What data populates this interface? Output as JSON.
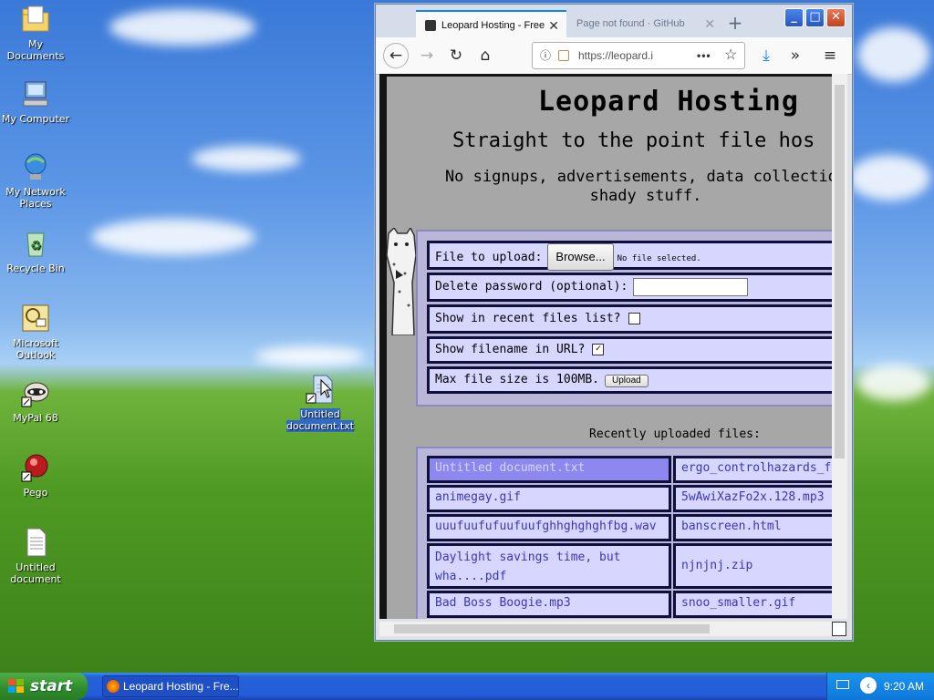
{
  "desktop": {
    "icons": [
      {
        "label": "My Documents",
        "icon": "folder-documents-icon"
      },
      {
        "label": "My Computer",
        "icon": "computer-icon"
      },
      {
        "label": "My Network Places",
        "icon": "network-icon"
      },
      {
        "label": "Recycle Bin",
        "icon": "recycle-bin-icon"
      },
      {
        "label": "Microsoft Outlook",
        "icon": "outlook-icon"
      },
      {
        "label": "MyPal 68",
        "icon": "mypal-icon"
      },
      {
        "label": "Pego",
        "icon": "pego-icon"
      },
      {
        "label": "Untitled document",
        "icon": "text-file-icon"
      },
      {
        "label": "Untitled document.txt",
        "icon": "text-file-shortcut-icon"
      }
    ]
  },
  "browser": {
    "tabs": [
      {
        "label": "Leopard Hosting - Free",
        "active": true
      },
      {
        "label": "Page not found · GitHub",
        "active": false
      }
    ],
    "url": "https://leopard.i",
    "window_buttons": {
      "minimize": "_",
      "maximize": "□",
      "close": "✕"
    }
  },
  "page": {
    "title": "Leopard Hosting",
    "subtitle": "Straight to the point file hos",
    "description_line1": "No signups, advertisements, data collection",
    "description_line2": "shady stuff.",
    "form": {
      "file_label": "File to upload:",
      "browse_label": "Browse...",
      "no_file_text": "No file selected.",
      "password_label": "Delete password (optional):",
      "password_value": "",
      "recent_label": "Show in recent files list?",
      "recent_checked": false,
      "filename_label": "Show filename in URL?",
      "filename_checked": true,
      "maxsize_label": "Max file size is 100MB.",
      "upload_label": "Upload"
    },
    "recent_title": "Recently uploaded files:",
    "recent_files": [
      [
        "Untitled document.txt",
        "ergo_controlhazards_f"
      ],
      [
        "animegay.gif",
        "5wAwiXazFo2x.128.mp3"
      ],
      [
        "uuufuufufuufuufghhghghghfbg.wav",
        "banscreen.html"
      ],
      [
        "Daylight savings time, but wha....pdf",
        "njnjnj.zip"
      ],
      [
        "Bad Boss Boogie.mp3",
        "snoo_smaller.gif"
      ]
    ]
  },
  "taskbar": {
    "start_label": "start",
    "task_label": "Leopard Hosting - Fre...",
    "clock": "9:20 AM"
  },
  "colors": {
    "accent": "#0a84ff",
    "row_bg": "#d7d6ff",
    "link": "#3a37b8",
    "highlight": "#8c88f0"
  }
}
